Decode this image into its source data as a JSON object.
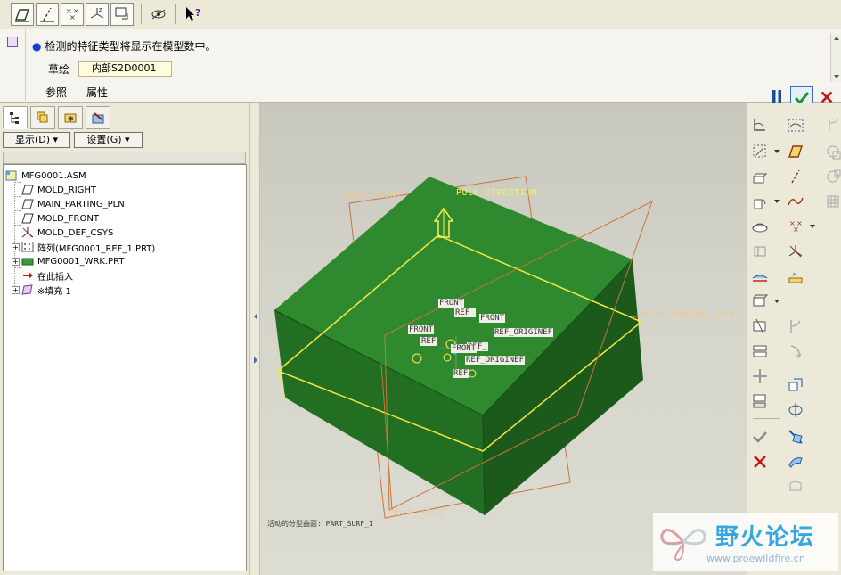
{
  "toolbar": {
    "buttons": [
      "datum-plane",
      "datum-axis",
      "datum-point",
      "datum-csys",
      "sketch",
      "hide-datums",
      "context-help"
    ]
  },
  "dashboard": {
    "message": "检测的特征类型将显示在模型数中。",
    "sketch_label": "草绘",
    "sketch_value": "内部S2D0001",
    "tab_references": "参照",
    "tab_properties": "属性"
  },
  "navigator": {
    "show_button": "显示(D)",
    "settings_button": "设置(G)",
    "tree": [
      {
        "label": "MFG0001.ASM",
        "icon": "assembly-icon",
        "level": 0
      },
      {
        "label": "MOLD_RIGHT",
        "icon": "plane-icon",
        "level": 1
      },
      {
        "label": "MAIN_PARTING_PLN",
        "icon": "plane-icon",
        "level": 1
      },
      {
        "label": "MOLD_FRONT",
        "icon": "plane-icon",
        "level": 1
      },
      {
        "label": "MOLD_DEF_CSYS",
        "icon": "csys-icon",
        "level": 1
      },
      {
        "label": "阵列(MFG0001_REF_1.PRT)",
        "icon": "pattern-icon",
        "level": 1,
        "expandable": true
      },
      {
        "label": "MFG0001_WRK.PRT",
        "icon": "workpiece-icon",
        "level": 1,
        "expandable": true
      },
      {
        "label": "在此插入",
        "icon": "insert-here-icon",
        "level": 1
      },
      {
        "label": "※填充 1",
        "icon": "fill-icon",
        "level": 1,
        "expandable": true
      }
    ]
  },
  "viewport": {
    "label_mold_front": "MOLD_FRONT",
    "label_pull_direction": "PULL DIRECTION",
    "label_main_parting": "MAIN_PARTING_PLN",
    "label_mold_right": "MOLD_RIGHT",
    "status_text": "活动的分型曲面: PART_SURF_1",
    "datum_tags": [
      "FRONT",
      "REF_",
      "FRONT",
      "FRONT",
      "REF_ORIGINEF",
      "REF",
      "REF_",
      "REF_ORIGINEF",
      "FRONT",
      "REF"
    ],
    "colors": {
      "workpiece": "#2e7d32",
      "workpiece_dark": "#1f5e1f",
      "datum": "#c8763a",
      "highlight": "#f5e640"
    }
  },
  "watermark": {
    "title": "野火论坛",
    "url": "www.proewildfire.cn"
  }
}
